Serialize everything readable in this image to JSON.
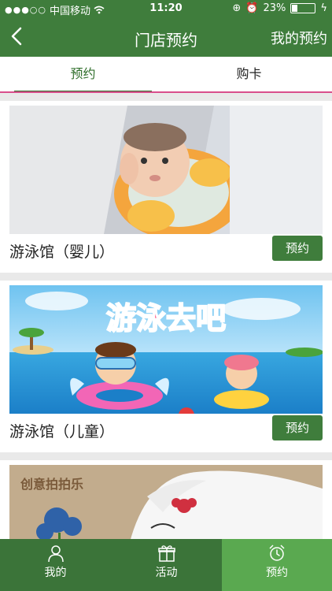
{
  "status": {
    "carrier": "中国移动",
    "time": "11:20",
    "battery": "23%",
    "battery_level": 0.23
  },
  "navbar": {
    "title": "门店预约",
    "right_link": "我的预约"
  },
  "tabs": [
    {
      "label": "预约"
    },
    {
      "label": "购卡"
    }
  ],
  "stores": [
    {
      "name": "游泳馆（婴儿）",
      "button": "预约"
    },
    {
      "name": "游泳馆（儿童）",
      "button": "预约",
      "banner_text": "游泳去吧"
    },
    {
      "banner_text": "创意拍拍乐"
    }
  ],
  "bottom_tabs": [
    {
      "label": "我的",
      "icon": "person-icon"
    },
    {
      "label": "活动",
      "icon": "gift-icon"
    },
    {
      "label": "预约",
      "icon": "alarm-clock-icon"
    }
  ],
  "colors": {
    "primary": "#3f7d3c",
    "active_tab": "#5aa950",
    "accent_line": "#d94f8c"
  }
}
